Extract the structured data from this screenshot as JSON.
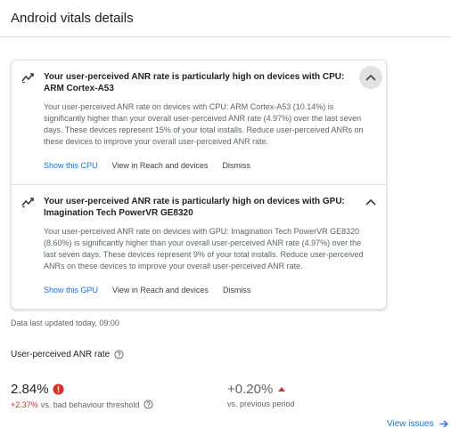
{
  "page": {
    "title": "Android vitals details"
  },
  "cards": [
    {
      "title": "Your user-perceived ANR rate is particularly high on devices with CPU: ARM Cortex-A53",
      "body": "Your user-perceived ANR rate on devices with CPU: ARM Cortex-A53 (10.14%) is significantly higher than your overall user-perceived ANR rate (4.97%) over the last seven days. These devices represent 15% of your total installs. Reduce user-perceived ANRs on these devices to improve your overall user-perceived ANR rate.",
      "actions": {
        "show": "Show this CPU",
        "reach": "View in Reach and devices",
        "dismiss": "Dismiss"
      },
      "icon": "trending-up-icon",
      "expanded_icon": "chevron-up-icon"
    },
    {
      "title": "Your user-perceived ANR rate is particularly high on devices with GPU: Imagination Tech PowerVR GE8320",
      "body": "Your user-perceived ANR rate on devices with GPU: Imagination Tech PowerVR GE8320 (8.60%) is significantly higher than your overall user-perceived ANR rate (4.97%) over the last seven days. These devices represent 9% of your total installs. Reduce user-perceived ANRs on these devices to improve your overall user-perceived ANR rate.",
      "actions": {
        "show": "Show this GPU",
        "reach": "View in Reach and devices",
        "dismiss": "Dismiss"
      },
      "icon": "trending-up-icon",
      "expanded_icon": "chevron-up-icon"
    }
  ],
  "updated": "Data last updated today, 09:00",
  "metric": {
    "label": "User-perceived ANR rate",
    "value": "2.84%",
    "delta_threshold": "+2.37%",
    "delta_threshold_suffix": "vs. bad behaviour threshold",
    "change": "+0.20%",
    "change_suffix": "vs. previous period"
  },
  "view_issues": "View issues",
  "colors": {
    "link": "#1a73e8",
    "error": "#d93025",
    "text": "#202124",
    "muted": "#5f6368"
  }
}
